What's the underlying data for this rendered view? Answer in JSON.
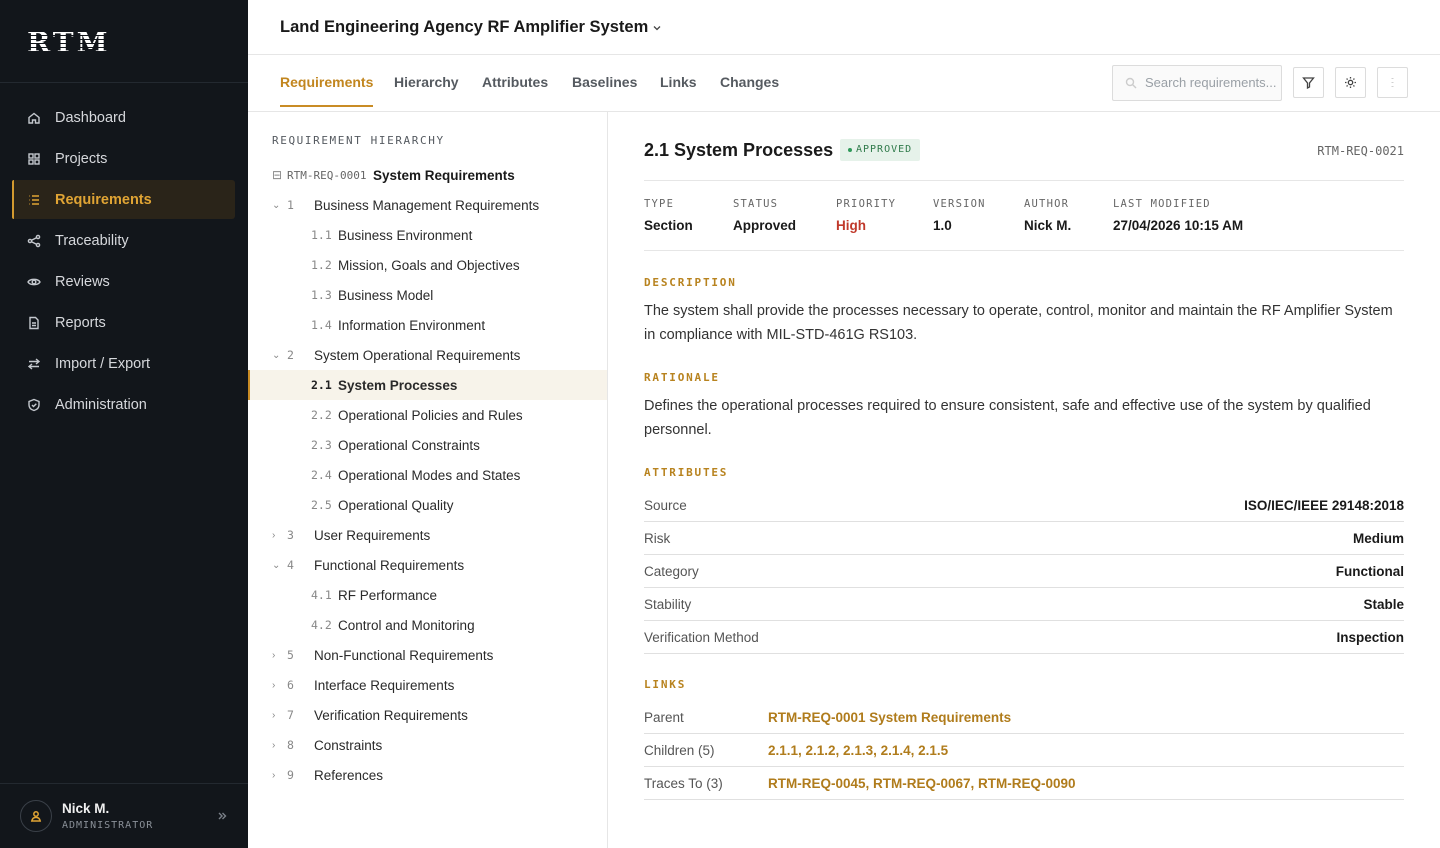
{
  "app": {
    "logo": "RTM"
  },
  "sidebar": {
    "items": [
      {
        "label": "Dashboard",
        "icon": "home-icon"
      },
      {
        "label": "Projects",
        "icon": "grid-icon"
      },
      {
        "label": "Requirements",
        "icon": "list-icon",
        "active": true
      },
      {
        "label": "Traceability",
        "icon": "share-icon"
      },
      {
        "label": "Reviews",
        "icon": "eye-icon"
      },
      {
        "label": "Reports",
        "icon": "document-icon"
      },
      {
        "label": "Import / Export",
        "icon": "swap-icon"
      },
      {
        "label": "Administration",
        "icon": "shield-icon"
      }
    ],
    "user": {
      "name": "Nick M.",
      "role": "ADMINISTRATOR"
    }
  },
  "header": {
    "project_title": "Land Engineering Agency RF Amplifier System"
  },
  "tabs": [
    "Requirements",
    "Hierarchy",
    "Attributes",
    "Baselines",
    "Links",
    "Changes"
  ],
  "search": {
    "placeholder": "Search requirements..."
  },
  "tree": {
    "heading": "REQUIREMENT HIERARCHY",
    "root": {
      "toggle": "⊟",
      "id": "RTM-REQ-0001",
      "label": "System Requirements"
    },
    "rows": [
      {
        "toggle": "⌄",
        "num": "1",
        "label": "Business Management Requirements",
        "level": 1
      },
      {
        "num": "1.1",
        "label": "Business Environment",
        "level": 2
      },
      {
        "num": "1.2",
        "label": "Mission, Goals and Objectives",
        "level": 2
      },
      {
        "num": "1.3",
        "label": "Business Model",
        "level": 2
      },
      {
        "num": "1.4",
        "label": "Information Environment",
        "level": 2
      },
      {
        "toggle": "⌄",
        "num": "2",
        "label": "System Operational Requirements",
        "level": 1
      },
      {
        "num": "2.1",
        "label": "System Processes",
        "level": 2,
        "selected": true
      },
      {
        "num": "2.2",
        "label": "Operational Policies and Rules",
        "level": 2
      },
      {
        "num": "2.3",
        "label": "Operational Constraints",
        "level": 2
      },
      {
        "num": "2.4",
        "label": "Operational Modes and States",
        "level": 2
      },
      {
        "num": "2.5",
        "label": "Operational Quality",
        "level": 2
      },
      {
        "toggle": "›",
        "num": "3",
        "label": "User Requirements",
        "level": 1
      },
      {
        "toggle": "⌄",
        "num": "4",
        "label": "Functional Requirements",
        "level": 1
      },
      {
        "num": "4.1",
        "label": "RF Performance",
        "level": 2
      },
      {
        "num": "4.2",
        "label": "Control and Monitoring",
        "level": 2
      },
      {
        "toggle": "›",
        "num": "5",
        "label": "Non-Functional Requirements",
        "level": 1
      },
      {
        "toggle": "›",
        "num": "6",
        "label": "Interface Requirements",
        "level": 1
      },
      {
        "toggle": "›",
        "num": "7",
        "label": "Verification Requirements",
        "level": 1
      },
      {
        "toggle": "›",
        "num": "8",
        "label": "Constraints",
        "level": 1
      },
      {
        "toggle": "›",
        "num": "9",
        "label": "References",
        "level": 1
      }
    ]
  },
  "detail": {
    "title": "2.1 System Processes",
    "status_badge": "APPROVED",
    "req_id": "RTM-REQ-0021",
    "meta": [
      {
        "key": "TYPE",
        "value": "Section"
      },
      {
        "key": "STATUS",
        "value": "Approved"
      },
      {
        "key": "PRIORITY",
        "value": "High"
      },
      {
        "key": "VERSION",
        "value": "1.0"
      },
      {
        "key": "AUTHOR",
        "value": "Nick M."
      },
      {
        "key": "LAST MODIFIED",
        "value": "27/04/2026 10:15 AM"
      }
    ],
    "description_heading": "DESCRIPTION",
    "description": "The system shall provide the processes necessary to operate, control, monitor and maintain the RF Amplifier System in compliance with MIL-STD-461G RS103.",
    "rationale_heading": "RATIONALE",
    "rationale": "Defines the operational processes required to ensure consistent, safe and effective use of the system by qualified personnel.",
    "attributes_heading": "ATTRIBUTES",
    "attributes": [
      {
        "key": "Source",
        "value": "ISO/IEC/IEEE 29148:2018"
      },
      {
        "key": "Risk",
        "value": "Medium"
      },
      {
        "key": "Category",
        "value": "Functional"
      },
      {
        "key": "Stability",
        "value": "Stable"
      },
      {
        "key": "Verification Method",
        "value": "Inspection"
      }
    ],
    "links_heading": "LINKS",
    "links": [
      {
        "key": "Parent",
        "value": "RTM-REQ-0001 System Requirements"
      },
      {
        "key": "Children (5)",
        "value": "2.1.1, 2.1.2, 2.1.3, 2.1.4, 2.1.5"
      },
      {
        "key": "Traces To (3)",
        "value": "RTM-REQ-0045, RTM-REQ-0067, RTM-REQ-0090"
      }
    ]
  },
  "colors": {
    "accent": "#c98c25",
    "sidebar_bg": "#12161b",
    "approved": "#2f7a4a",
    "high_priority": "#c0392b"
  }
}
